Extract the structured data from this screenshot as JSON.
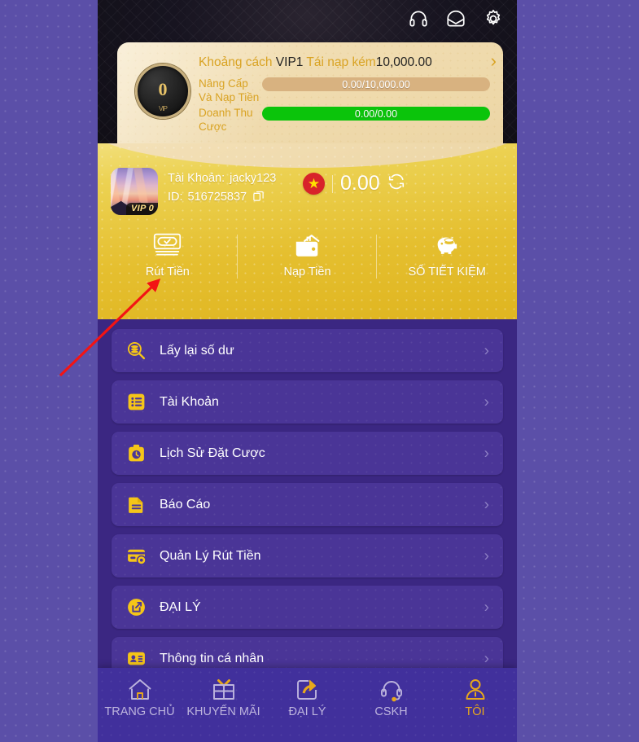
{
  "header": {
    "icons": [
      {
        "name": "headset-icon",
        "label": "CSKH"
      },
      {
        "name": "mail-icon",
        "label": "Tin nhắn"
      },
      {
        "name": "gear-icon",
        "label": "Cài đặt"
      }
    ]
  },
  "vip_card": {
    "medal_level": "0",
    "medal_wreath": "VIP",
    "headline_prefix": "Khoảng cách ",
    "headline_vip": "VIP1",
    "headline_middle": " Tái nạp kém",
    "headline_amount": "10,000.00",
    "chevron": "›",
    "rows": [
      {
        "label": "Nâng Cấp Và Nạp Tiền",
        "value": "0.00/10,000.00",
        "bar": "tan",
        "color": "#d8b280"
      },
      {
        "label": "Doanh Thu Cược",
        "value": "0.00/0.00",
        "bar": "green",
        "color": "#0bc40b"
      }
    ]
  },
  "account": {
    "avatar_vip_badge": "VIP 0",
    "account_label": "Tài Khoản:",
    "account_value": "jacky123",
    "id_label": "ID:",
    "id_value": "516725837",
    "copy_icon": "copy-icon",
    "flag_icon": "vietnam-flag-icon",
    "balance": "0.00",
    "refresh_icon": "refresh-icon"
  },
  "actions": [
    {
      "icon": "banknote-check-icon",
      "label": "Rút Tiền"
    },
    {
      "icon": "wallet-deposit-icon",
      "label": "Nạp Tiền"
    },
    {
      "icon": "piggy-bank-icon",
      "label": "SỔ TIẾT KIỆM"
    }
  ],
  "menu": [
    {
      "icon": "coins-search-icon",
      "label": "Lấy lại số dư",
      "chevron": "›"
    },
    {
      "icon": "list-card-icon",
      "label": "Tài Khoản",
      "chevron": "›"
    },
    {
      "icon": "bet-history-clock-icon",
      "label": "Lịch Sử Đặt Cược",
      "chevron": "›"
    },
    {
      "icon": "report-document-icon",
      "label": "Báo Cáo",
      "chevron": "›"
    },
    {
      "icon": "withdraw-settings-card-icon",
      "label": "Quản Lý Rút Tiền",
      "chevron": "›"
    },
    {
      "icon": "agent-share-icon",
      "label": "ĐẠI LÝ",
      "chevron": "›"
    },
    {
      "icon": "id-card-icon",
      "label": "Thông tin cá nhân",
      "chevron": "›"
    }
  ],
  "bottom_nav": [
    {
      "icon": "home-icon",
      "label": "TRANG CHỦ",
      "active": false
    },
    {
      "icon": "gift-icon",
      "label": "KHUYẾN MÃI",
      "active": false
    },
    {
      "icon": "share-arrow-icon",
      "label": "ĐẠI LÝ",
      "active": false
    },
    {
      "icon": "headset-support-icon",
      "label": "CSKH",
      "active": false
    },
    {
      "icon": "user-person-icon",
      "label": "TÔI",
      "active": true
    }
  ],
  "annotation": {
    "arrow_color": "#f31414",
    "arrow_target": "Rút Tiền"
  },
  "colors": {
    "page_bg": "#5b4fa8",
    "app_bg": "#3b2782",
    "gold": "#e5bf2f",
    "accent_yellow": "#f5c518",
    "menu_card": "#4a3597"
  }
}
